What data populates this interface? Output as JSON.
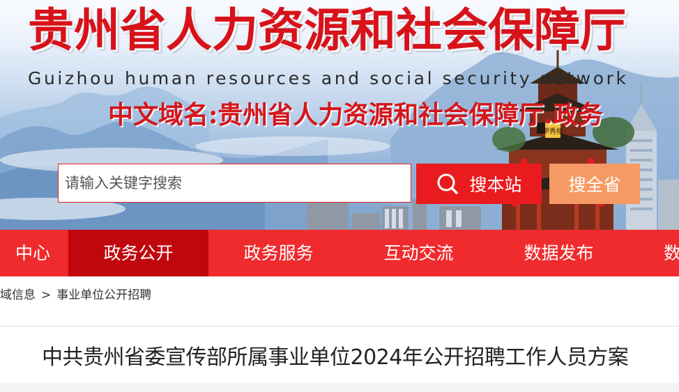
{
  "banner": {
    "title": "贵州省人力资源和社会保障厅",
    "subtitle": "Guizhou human resources and social security network",
    "domain_line": "中文域名:贵州省人力资源和社会保障厅.政务",
    "pavilion_plaque": "甲秀楼"
  },
  "search": {
    "placeholder": "请输入关键字搜索",
    "value": "",
    "site_button_label": "搜本站",
    "province_button_label": "搜全省"
  },
  "nav": {
    "items": [
      {
        "label": "中心",
        "active": false
      },
      {
        "label": "政务公开",
        "active": true
      },
      {
        "label": "政务服务",
        "active": false
      },
      {
        "label": "互动交流",
        "active": false
      },
      {
        "label": "数据发布",
        "active": false
      },
      {
        "label": "数",
        "active": false
      }
    ]
  },
  "breadcrumb": {
    "items": [
      "域信息",
      "事业单位公开招聘"
    ],
    "separator": ">"
  },
  "article": {
    "title": "中共贵州省委宣传部所属事业单位2024年公开招聘工作人员方案"
  },
  "colors": {
    "brand_red": "#ef2b2e",
    "active_nav": "#c0070d",
    "search_button": "#ea1b1e",
    "province_button": "#f59a64",
    "title_red": "#d7121a"
  },
  "icons": {
    "search_button_icon": "search-icon",
    "breadcrumb_separator": "chevron-right"
  }
}
